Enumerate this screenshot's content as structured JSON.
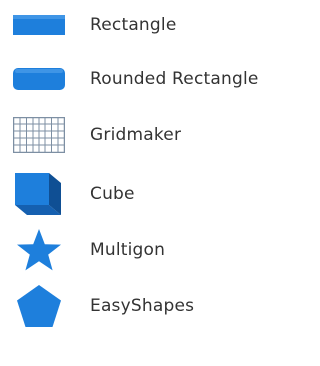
{
  "shapes": [
    {
      "label": "Rectangle",
      "icon": "rectangle-icon"
    },
    {
      "label": "Rounded Rectangle",
      "icon": "rounded-rectangle-icon"
    },
    {
      "label": "Gridmaker",
      "icon": "grid-icon"
    },
    {
      "label": "Cube",
      "icon": "cube-icon"
    },
    {
      "label": "Multigon",
      "icon": "star-icon"
    },
    {
      "label": "EasyShapes",
      "icon": "pentagon-icon"
    }
  ],
  "colors": {
    "accent": "#1e7fdc",
    "accent_dark": "#1560b0",
    "grid": "#7d8fa3",
    "text": "#333333"
  }
}
